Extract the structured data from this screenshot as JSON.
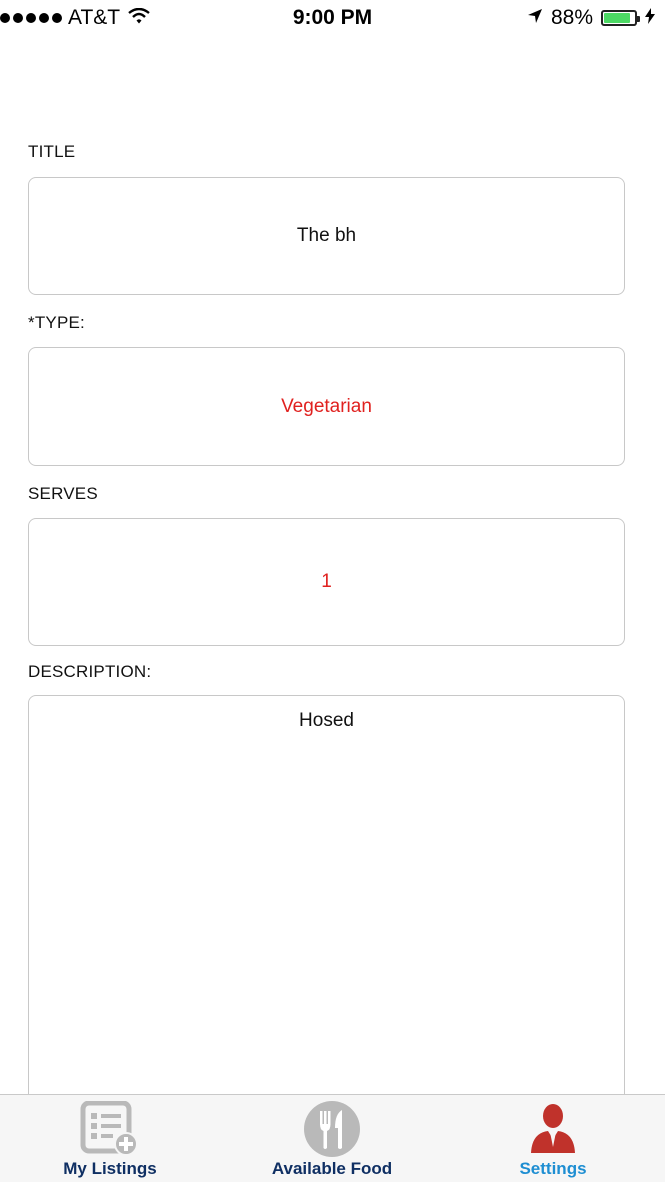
{
  "status_bar": {
    "carrier": "AT&T",
    "time": "9:00 PM",
    "battery": "88%",
    "battery_level": 0.88
  },
  "form": {
    "title_label": "TITLE",
    "title_value": "The bh",
    "type_label": "*TYPE:",
    "type_value": "Vegetarian",
    "serves_label": "SERVES",
    "serves_value": "1",
    "description_label": "DESCRIPTION:",
    "description_value": "Hosed"
  },
  "tab_bar": {
    "tabs": [
      {
        "label": "My Listings",
        "icon": "listings-add-icon"
      },
      {
        "label": "Available Food",
        "icon": "fork-knife-icon"
      },
      {
        "label": "Settings",
        "icon": "user-icon"
      }
    ],
    "active_tab": "Settings"
  },
  "colors": {
    "accent_red": "#e0211f",
    "tab_dark": "#0f2f63",
    "tab_active": "#1e8ed2",
    "battery_green": "#4cd964"
  }
}
